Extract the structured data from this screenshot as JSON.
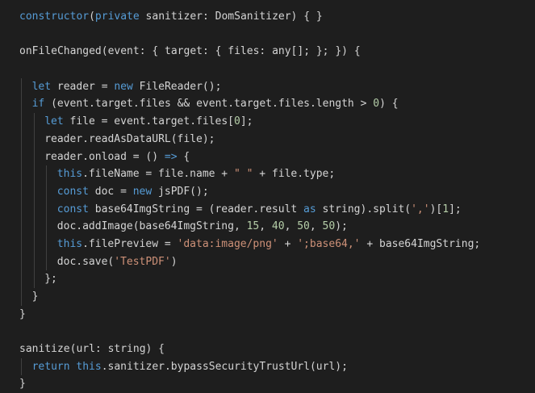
{
  "colors": {
    "background": "#1e1e1e",
    "keyword": "#569cd6",
    "function": "#dcdcaa",
    "identifier": "#d4d4d4",
    "string": "#ce9178",
    "number": "#b5cea8",
    "indent_guide": "#404040"
  },
  "lines": [
    {
      "indent": 0,
      "tokens": [
        [
          "kw",
          "constructor"
        ],
        [
          "id",
          "("
        ],
        [
          "kw",
          "private"
        ],
        [
          "id",
          " sanitizer: DomSanitizer) { }"
        ]
      ]
    },
    {
      "indent": 0,
      "tokens": []
    },
    {
      "indent": 0,
      "tokens": [
        [
          "id",
          "onFileChanged(event: { target: { files: any[]; }; }) {"
        ]
      ]
    },
    {
      "indent": 0,
      "tokens": []
    },
    {
      "indent": 1,
      "tokens": [
        [
          "kw",
          "let"
        ],
        [
          "id",
          " reader = "
        ],
        [
          "kw",
          "new"
        ],
        [
          "id",
          " FileReader();"
        ]
      ]
    },
    {
      "indent": 1,
      "tokens": [
        [
          "kw",
          "if"
        ],
        [
          "id",
          " (event.target.files && event.target.files.length > "
        ],
        [
          "num",
          "0"
        ],
        [
          "id",
          ") {"
        ]
      ]
    },
    {
      "indent": 2,
      "tokens": [
        [
          "kw",
          "let"
        ],
        [
          "id",
          " file = event.target.files["
        ],
        [
          "num",
          "0"
        ],
        [
          "id",
          "];"
        ]
      ]
    },
    {
      "indent": 2,
      "tokens": [
        [
          "id",
          "reader.readAsDataURL(file);"
        ]
      ]
    },
    {
      "indent": 2,
      "tokens": [
        [
          "id",
          "reader.onload = () "
        ],
        [
          "kw",
          "=>"
        ],
        [
          "id",
          " {"
        ]
      ]
    },
    {
      "indent": 3,
      "tokens": [
        [
          "kw",
          "this"
        ],
        [
          "id",
          ".fileName = file.name + "
        ],
        [
          "str",
          "\" \""
        ],
        [
          "id",
          " + file.type;"
        ]
      ]
    },
    {
      "indent": 3,
      "tokens": [
        [
          "kw",
          "const"
        ],
        [
          "id",
          " doc = "
        ],
        [
          "kw",
          "new"
        ],
        [
          "id",
          " jsPDF();"
        ]
      ]
    },
    {
      "indent": 3,
      "tokens": [
        [
          "kw",
          "const"
        ],
        [
          "id",
          " base64ImgString = (reader.result "
        ],
        [
          "kw",
          "as"
        ],
        [
          "id",
          " string).split("
        ],
        [
          "str",
          "','"
        ],
        [
          "id",
          ")["
        ],
        [
          "num",
          "1"
        ],
        [
          "id",
          "];"
        ]
      ]
    },
    {
      "indent": 3,
      "tokens": [
        [
          "id",
          "doc.addImage(base64ImgString, "
        ],
        [
          "num",
          "15"
        ],
        [
          "id",
          ", "
        ],
        [
          "num",
          "40"
        ],
        [
          "id",
          ", "
        ],
        [
          "num",
          "50"
        ],
        [
          "id",
          ", "
        ],
        [
          "num",
          "50"
        ],
        [
          "id",
          ");"
        ]
      ]
    },
    {
      "indent": 3,
      "tokens": [
        [
          "kw",
          "this"
        ],
        [
          "id",
          ".filePreview = "
        ],
        [
          "str",
          "'data:image/png'"
        ],
        [
          "id",
          " + "
        ],
        [
          "str",
          "';base64,'"
        ],
        [
          "id",
          " + base64ImgString;"
        ]
      ]
    },
    {
      "indent": 3,
      "tokens": [
        [
          "id",
          "doc.save("
        ],
        [
          "str",
          "'TestPDF'"
        ],
        [
          "id",
          ")"
        ]
      ]
    },
    {
      "indent": 2,
      "tokens": [
        [
          "id",
          "};"
        ]
      ]
    },
    {
      "indent": 1,
      "tokens": [
        [
          "id",
          "}"
        ]
      ]
    },
    {
      "indent": 0,
      "tokens": [
        [
          "id",
          "}"
        ]
      ]
    },
    {
      "indent": 0,
      "tokens": []
    },
    {
      "indent": 0,
      "tokens": [
        [
          "id",
          "sanitize(url: string) {"
        ]
      ]
    },
    {
      "indent": 1,
      "tokens": [
        [
          "kw",
          "return"
        ],
        [
          "id",
          " "
        ],
        [
          "kw",
          "this"
        ],
        [
          "id",
          ".sanitizer.bypassSecurityTrustUrl(url);"
        ]
      ]
    },
    {
      "indent": 0,
      "tokens": [
        [
          "id",
          "}"
        ]
      ]
    }
  ]
}
